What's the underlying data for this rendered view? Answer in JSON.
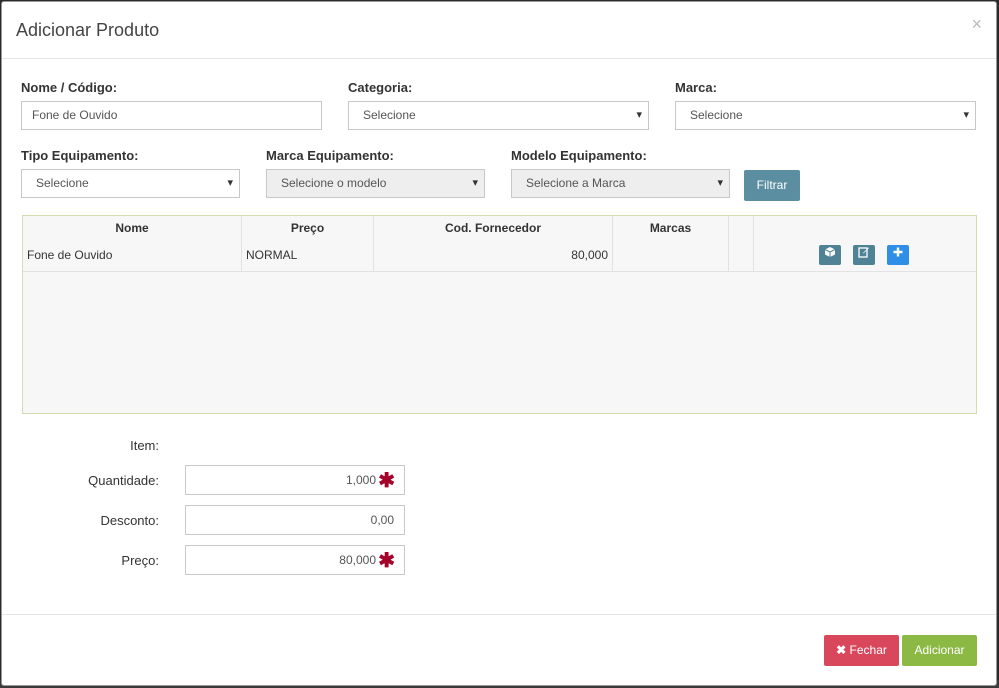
{
  "dialog": {
    "title": "Adicionar Produto",
    "close_glyph": "×"
  },
  "filters": {
    "nome_codigo": {
      "label": "Nome / Código:",
      "value": "Fone de Ouvido"
    },
    "categoria": {
      "label": "Categoria:",
      "value": "Selecione"
    },
    "marca": {
      "label": "Marca:",
      "value": "Selecione"
    },
    "tipo_equipamento": {
      "label": "Tipo Equipamento:",
      "value": "Selecione"
    },
    "marca_equipamento": {
      "label": "Marca Equipamento:",
      "value": "Selecione o modelo"
    },
    "modelo_equipamento": {
      "label": "Modelo Equipamento:",
      "value": "Selecione a Marca"
    },
    "filter_button": "Filtrar"
  },
  "table": {
    "headers": [
      "Nome",
      "Preço",
      "Cod. Fornecedor",
      "Marcas"
    ],
    "rows": [
      {
        "nome": "Fone de Ouvido",
        "preco": "NORMAL",
        "cod_fornecedor": "80,000",
        "marcas": ""
      }
    ],
    "actions": [
      {
        "icon": "cube-icon",
        "color": "#4f8294"
      },
      {
        "icon": "edit-icon",
        "color": "#4f8294"
      },
      {
        "icon": "plus-icon",
        "color": "#2f8ee5"
      }
    ]
  },
  "form": {
    "item": {
      "label": "Item:"
    },
    "quantidade": {
      "label": "Quantidade:",
      "value": "1,000",
      "required": true
    },
    "desconto": {
      "label": "Desconto:",
      "value": "0,00"
    },
    "preco": {
      "label": "Preço:",
      "value": "80,000",
      "required": true
    }
  },
  "footer": {
    "close_button": "Fechar",
    "close_icon": "x-icon",
    "add_button": "Adicionar",
    "colors": {
      "close": "#d9475d",
      "add": "#8cb944"
    }
  }
}
